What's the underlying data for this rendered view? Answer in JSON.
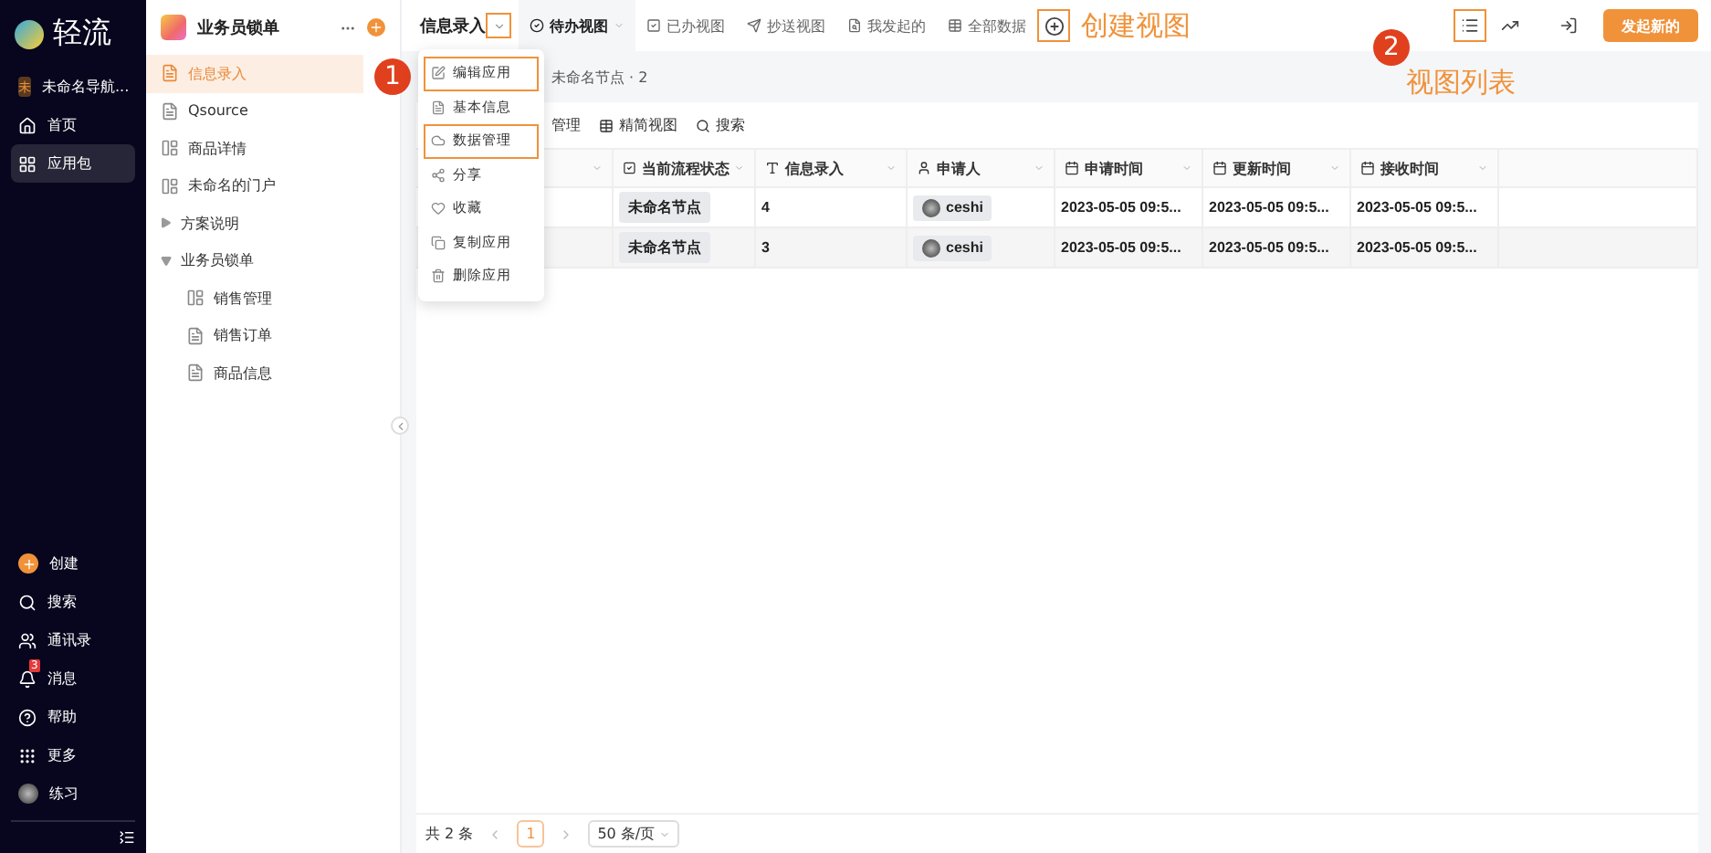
{
  "nav": {
    "logo": "轻流",
    "workspace": {
      "badge": "未",
      "name": "未命名导航..."
    },
    "items": [
      {
        "label": "首页",
        "selected": false
      },
      {
        "label": "应用包",
        "selected": true
      }
    ],
    "bottom_items": [
      {
        "label": "创建"
      },
      {
        "label": "搜索"
      },
      {
        "label": "通讯录"
      },
      {
        "label": "消息",
        "badge": "3"
      },
      {
        "label": "帮助"
      },
      {
        "label": "更多"
      },
      {
        "label": "练习"
      }
    ]
  },
  "app_sidebar": {
    "title": "业务员锁单",
    "items": [
      {
        "label": "信息录入",
        "kind": "form",
        "selected": true
      },
      {
        "label": "Qsource",
        "kind": "form",
        "selected": false
      },
      {
        "label": "商品详情",
        "kind": "portal",
        "selected": false
      },
      {
        "label": "未命名的门户",
        "kind": "portal",
        "selected": false
      },
      {
        "label": "方案说明",
        "kind": "folder",
        "selected": false,
        "expanded": false
      },
      {
        "label": "业务员锁单",
        "kind": "folder",
        "selected": false,
        "expanded": true,
        "children": [
          {
            "label": "销售管理",
            "kind": "portal",
            "selected": false
          },
          {
            "label": "销售订单",
            "kind": "form",
            "selected": false
          },
          {
            "label": "商品信息",
            "kind": "form",
            "selected": false
          }
        ]
      }
    ]
  },
  "top_bar": {
    "app_title": "信息录入",
    "app_menu_highlighted": true,
    "step": "1",
    "views": [
      {
        "label": "待办视图",
        "selected": true
      },
      {
        "label": "已办视图",
        "selected": false
      },
      {
        "label": "抄送视图",
        "selected": false
      },
      {
        "label": "我发起的",
        "selected": false
      },
      {
        "label": "全部数据",
        "selected": false
      }
    ],
    "add_view": {
      "highlighted": true,
      "callout": "创建视图"
    },
    "view_list": {
      "highlighted": true,
      "step": "2",
      "callout": "视图列表"
    },
    "new_button": "发起新的"
  },
  "app_menu": {
    "items": [
      {
        "label": "编辑应用",
        "highlighted": true
      },
      {
        "label": "基本信息",
        "highlighted": false
      },
      {
        "label": "数据管理",
        "highlighted": true
      },
      {
        "label": "分享",
        "highlighted": false
      },
      {
        "label": "收藏",
        "highlighted": false
      },
      {
        "label": "复制应用",
        "highlighted": false
      },
      {
        "label": "删除应用",
        "highlighted": false
      }
    ]
  },
  "breadcrumb": "未命名节点 · 2",
  "toolbar": [
    {
      "label": "管理"
    },
    {
      "label": "精简视图"
    },
    {
      "label": "搜索"
    }
  ],
  "table": {
    "columns": [
      {},
      {
        "label": "当前流程状态"
      },
      {
        "label": "信息录入"
      },
      {
        "label": "申请人"
      },
      {
        "label": "申请时间"
      },
      {
        "label": "更新时间"
      },
      {
        "label": "接收时间"
      }
    ],
    "rows": [
      {
        "status": "未命名节点",
        "info": "4",
        "applicant": "ceshi",
        "applied": "2023-05-05 09:5...",
        "updated": "2023-05-05 09:5...",
        "received": "2023-05-05 09:5..."
      },
      {
        "status": "未命名节点",
        "info": "3",
        "applicant": "ceshi",
        "applied": "2023-05-05 09:5...",
        "updated": "2023-05-05 09:5...",
        "received": "2023-05-05 09:5..."
      }
    ]
  },
  "pagination": {
    "total": "共 2 条",
    "pages": [
      {
        "label": "1",
        "selected": true
      }
    ],
    "page_size": "50 条/页"
  }
}
